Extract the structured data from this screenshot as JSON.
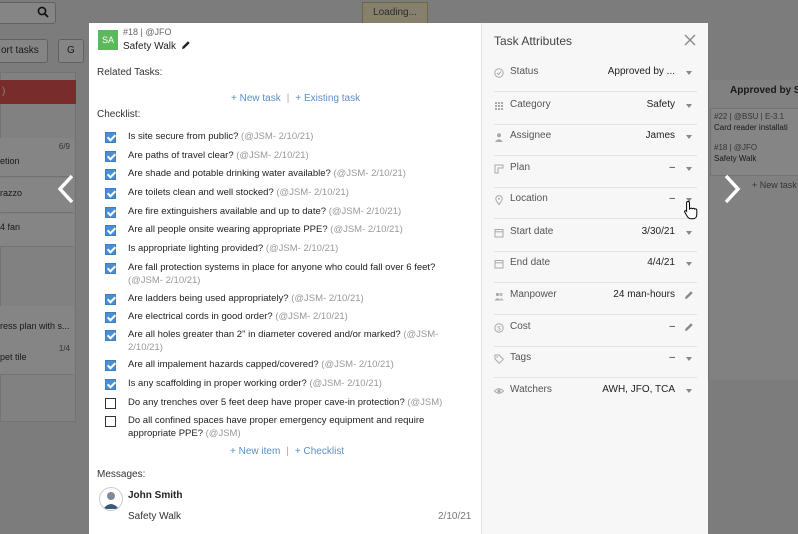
{
  "background": {
    "loading_text": "Loading...",
    "export_btn": "ort tasks",
    "print_btn": "G",
    "red_col_label": ")",
    "cards": [
      {
        "text": "etion",
        "count": "6/9"
      },
      {
        "text": "razzo",
        "count": ""
      },
      {
        "text": "4 fan",
        "count": ""
      },
      {
        "text": "ress plan with s...",
        "count": ""
      },
      {
        "text": "pet tile",
        "count": "1/4"
      }
    ],
    "right_column_header": "Approved by Su",
    "right_card_1_ref": "#22 | @BSU | E-3.1",
    "right_card_1_title": "Card reader installati",
    "right_card_2_ref": "#18 | @JFO",
    "right_card_2_title": "Safety Walk",
    "right_new_task": "+ New task"
  },
  "task": {
    "avatar_initials": "SA",
    "ref": "#18 | @JFO",
    "title": "Safety Walk"
  },
  "related": {
    "label": "Related Tasks:",
    "new_task_link": "+ New task",
    "existing_task_link": "+ Existing task",
    "separator": "|"
  },
  "checklist": {
    "label": "Checklist:",
    "items": [
      {
        "text": "Is site secure from public?",
        "meta": "(@JSM- 2/10/21)",
        "checked": true
      },
      {
        "text": "Are paths of travel clear?",
        "meta": "(@JSM- 2/10/21)",
        "checked": true
      },
      {
        "text": "Are shade and potable drinking water available?",
        "meta": "(@JSM- 2/10/21)",
        "checked": true
      },
      {
        "text": "Are toilets clean and well stocked?",
        "meta": "(@JSM- 2/10/21)",
        "checked": true
      },
      {
        "text": "Are fire extinguishers available and up to date?",
        "meta": "(@JSM- 2/10/21)",
        "checked": true
      },
      {
        "text": "Are all people onsite wearing appropriate PPE?",
        "meta": "(@JSM- 2/10/21)",
        "checked": true
      },
      {
        "text": "Is appropriate lighting provided?",
        "meta": "(@JSM- 2/10/21)",
        "checked": true
      },
      {
        "text": "Are fall protection systems in place for anyone who could fall over 6 feet?",
        "meta": "(@JSM- 2/10/21)",
        "checked": true
      },
      {
        "text": "Are ladders being used appropriately?",
        "meta": "(@JSM- 2/10/21)",
        "checked": true
      },
      {
        "text": "Are electrical cords in good order?",
        "meta": "(@JSM- 2/10/21)",
        "checked": true
      },
      {
        "text": "Are all holes greater than 2\" in diameter covered and/or marked?",
        "meta": "(@JSM- 2/10/21)",
        "checked": true
      },
      {
        "text": "Are all impalement hazards capped/covered?",
        "meta": "(@JSM- 2/10/21)",
        "checked": true
      },
      {
        "text": "Is any scaffolding in proper working order?",
        "meta": "(@JSM- 2/10/21)",
        "checked": true
      },
      {
        "text": "Do any trenches over 5 feet deep have proper cave-in protection?",
        "meta": "(@JSM)",
        "checked": false
      },
      {
        "text": "Do all confined spaces have proper emergency equipment and require appropriate PPE?",
        "meta": "(@JSM)",
        "checked": false
      }
    ],
    "new_item_link": "+ New item",
    "add_checklist_link": "+ Checklist",
    "separator": "|"
  },
  "messages": {
    "label": "Messages:",
    "items": [
      {
        "author": "John Smith",
        "text": "Safety Walk",
        "date": "2/10/21"
      }
    ]
  },
  "attributes": {
    "title": "Task Attributes",
    "rows": [
      {
        "label": "Status",
        "value": "Approved by ...",
        "icon": "status-check-icon",
        "control": "dropdown"
      },
      {
        "label": "Category",
        "value": "Safety",
        "icon": "category-grid-icon",
        "control": "dropdown"
      },
      {
        "label": "Assignee",
        "value": "James",
        "icon": "person-icon",
        "control": "dropdown"
      },
      {
        "label": "Plan",
        "value": "–",
        "icon": "plan-icon",
        "control": "dropdown"
      },
      {
        "label": "Location",
        "value": "–",
        "icon": "location-pin-icon",
        "control": "dropdown"
      },
      {
        "label": "Start date",
        "value": "3/30/21",
        "icon": "calendar-icon",
        "control": "dropdown"
      },
      {
        "label": "End date",
        "value": "4/4/21",
        "icon": "calendar-icon",
        "control": "dropdown"
      },
      {
        "label": "Manpower",
        "value": "24  man-hours",
        "icon": "people-icon",
        "control": "edit"
      },
      {
        "label": "Cost",
        "value": "–",
        "icon": "dollar-icon",
        "control": "edit"
      },
      {
        "label": "Tags",
        "value": "–",
        "icon": "tag-icon",
        "control": "dropdown"
      },
      {
        "label": "Watchers",
        "value": "AWH, JFO, TCA",
        "icon": "eye-icon",
        "control": "dropdown"
      }
    ]
  },
  "colors": {
    "accent_link": "#5a8fc6",
    "checkbox_blue": "#4a8fd3",
    "avatar_green": "#5cb85c",
    "red_column": "#e85555"
  }
}
